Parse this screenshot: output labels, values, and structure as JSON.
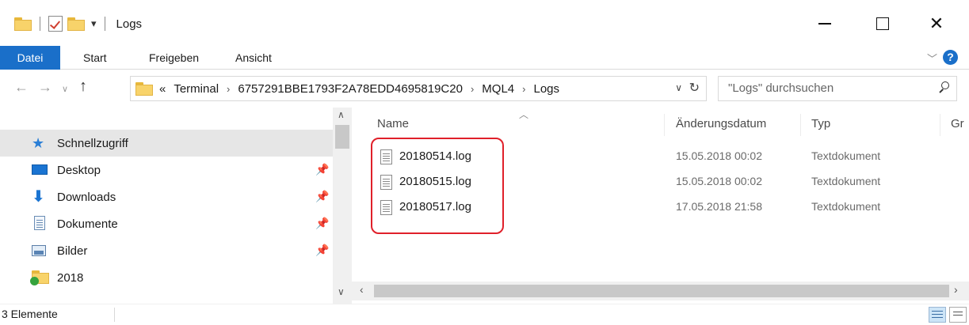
{
  "window": {
    "title": "Logs"
  },
  "ribbon": {
    "tabs": [
      {
        "label": "Datei"
      },
      {
        "label": "Start"
      },
      {
        "label": "Freigeben"
      },
      {
        "label": "Ansicht"
      }
    ],
    "help_label": "?"
  },
  "address": {
    "overflow": "«",
    "crumbs": [
      "Terminal",
      "6757291BBE1793F2A78EDD4695819C20",
      "MQL4",
      "Logs"
    ]
  },
  "search": {
    "placeholder": "\"Logs\" durchsuchen"
  },
  "navpane": {
    "items": [
      {
        "label": "Schnellzugriff",
        "icon": "star-icon",
        "selected": true,
        "pinned": false
      },
      {
        "label": "Desktop",
        "icon": "desktop-icon",
        "pinned": true
      },
      {
        "label": "Downloads",
        "icon": "download-icon",
        "pinned": true
      },
      {
        "label": "Dokumente",
        "icon": "documents-icon",
        "pinned": true
      },
      {
        "label": "Bilder",
        "icon": "pictures-icon",
        "pinned": true
      },
      {
        "label": "2018",
        "icon": "folder-icon",
        "pinned": false
      }
    ]
  },
  "files": {
    "columns": {
      "name": "Name",
      "date": "Änderungsdatum",
      "type": "Typ",
      "size": "Gr"
    },
    "rows": [
      {
        "name": "20180514.log",
        "date": "15.05.2018 00:02",
        "type": "Textdokument"
      },
      {
        "name": "20180515.log",
        "date": "15.05.2018 00:02",
        "type": "Textdokument"
      },
      {
        "name": "20180517.log",
        "date": "17.05.2018 21:58",
        "type": "Textdokument"
      }
    ]
  },
  "status": {
    "text": "3 Elemente"
  },
  "colors": {
    "accent": "#1a6fc9",
    "highlight": "#e0202a",
    "selected": "#e6e6e6"
  }
}
